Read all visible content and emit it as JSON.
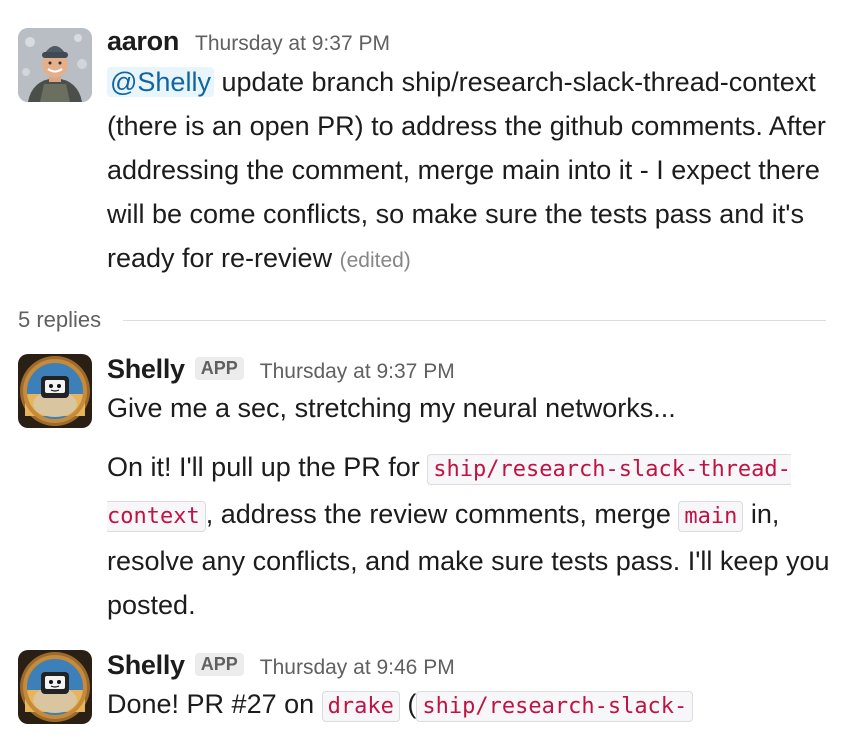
{
  "thread": {
    "parent": {
      "author": "aaron",
      "time": "Thursday at 9:37 PM",
      "mention": "@Shelly",
      "text": " update branch ship/research-slack-thread-context (there is an open PR) to address the github comments. After addressing the comment, merge main into it - I expect there will be come conflicts, so make sure the tests pass and it's ready for re-review",
      "edited": "(edited)"
    },
    "replies_count": "5 replies",
    "replies": [
      {
        "author": "Shelly",
        "badge": "APP",
        "time": "Thursday at 9:37 PM",
        "p1": "Give me a sec, stretching my neural networks...",
        "p2_a": "On it! I'll pull up the PR for ",
        "p2_code1": "ship/research-slack-thread-context",
        "p2_b": ", address the review comments, merge ",
        "p2_code2": "main",
        "p2_c": " in, resolve any conflicts, and make sure tests pass. I'll keep you posted."
      },
      {
        "author": "Shelly",
        "badge": "APP",
        "time": "Thursday at 9:46 PM",
        "t_a": "Done! PR #27 on ",
        "t_code1": "drake",
        "t_b": " (",
        "t_code2": "ship/research-slack-"
      }
    ]
  }
}
